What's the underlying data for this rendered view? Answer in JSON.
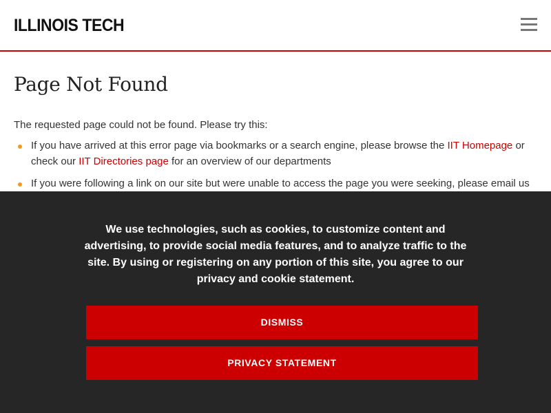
{
  "header": {
    "logo_text": "ILLINOIS TECH",
    "menu_icon": "hamburger-menu-icon",
    "accent_color": "#cc0000"
  },
  "main": {
    "title": "Page Not Found",
    "intro": "The requested page could not be found. Please try this:",
    "tip1": {
      "text_a": "If you have arrived at this error page via bookmarks or a search engine, please browse the ",
      "link1": "IIT Homepage",
      "text_b": " or check our ",
      "link2": "IIT Directories page",
      "text_c": " for an overview of our departments"
    },
    "tip2": {
      "text": "If you were following a link on our site but were unable to access the page you were seeking, please email us at"
    },
    "bullet_color": "#f29a1f"
  },
  "cookie": {
    "text": "We use technologies, such as cookies, to customize content and advertising, to provide social media features, and to analyze traffic to the site. By using or registering on any portion of this site, you agree to our privacy and cookie statement.",
    "dismiss_label": "DISMISS",
    "privacy_label": "PRIVACY STATEMENT",
    "background_color": "#262626",
    "button_color": "#cc0000"
  }
}
